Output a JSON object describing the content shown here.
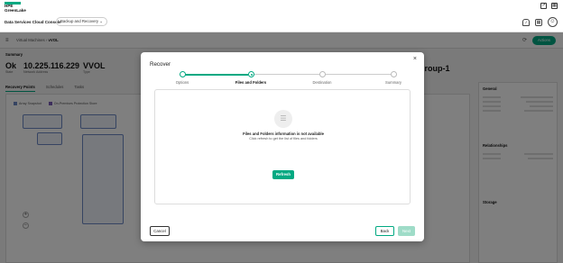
{
  "topbar": {
    "logo_line1": "HPE",
    "logo_line2": "GreenLake"
  },
  "appbar": {
    "console_label": "Data Services Cloud Console",
    "service_selector": "Backup and Recovery"
  },
  "background": {
    "breadcrumb_parent": "Virtual Machines",
    "breadcrumb_current": "vVOL",
    "actions_label": "Actions",
    "summary_label": "Summary",
    "stats": [
      {
        "value": "Ok",
        "label": "State"
      },
      {
        "value": "10.225.116.229",
        "label": "Network Address"
      },
      {
        "value": "VVOL",
        "label": "Type"
      }
    ],
    "title_fragment": "group-1",
    "tabs": [
      "Recovery Points",
      "Schedules",
      "Tasks"
    ],
    "legend": [
      "Array Snapshot",
      "On-Premises Protection Store"
    ],
    "panel_general": "General",
    "panel_relationships": "Relationships",
    "panel_storage": "Storage"
  },
  "modal": {
    "title": "Recover",
    "close_icon": "close-icon",
    "steps": [
      {
        "label": "Options",
        "state": "done"
      },
      {
        "label": "Files and Folders",
        "state": "current"
      },
      {
        "label": "Destination",
        "state": "pending"
      },
      {
        "label": "Summary",
        "state": "pending"
      }
    ],
    "empty_icon": "file-icon",
    "empty_title": "Files and Folders information is not available",
    "empty_subtitle": "Click refresh to get the list of files and folders",
    "refresh_label": "Refresh",
    "cancel_label": "Cancel",
    "back_label": "Back",
    "next_label": "Next"
  },
  "colors": {
    "accent": "#01a982",
    "accent_disabled": "#9fdcc8",
    "overlay": "rgba(0,0,0,0.5)"
  }
}
